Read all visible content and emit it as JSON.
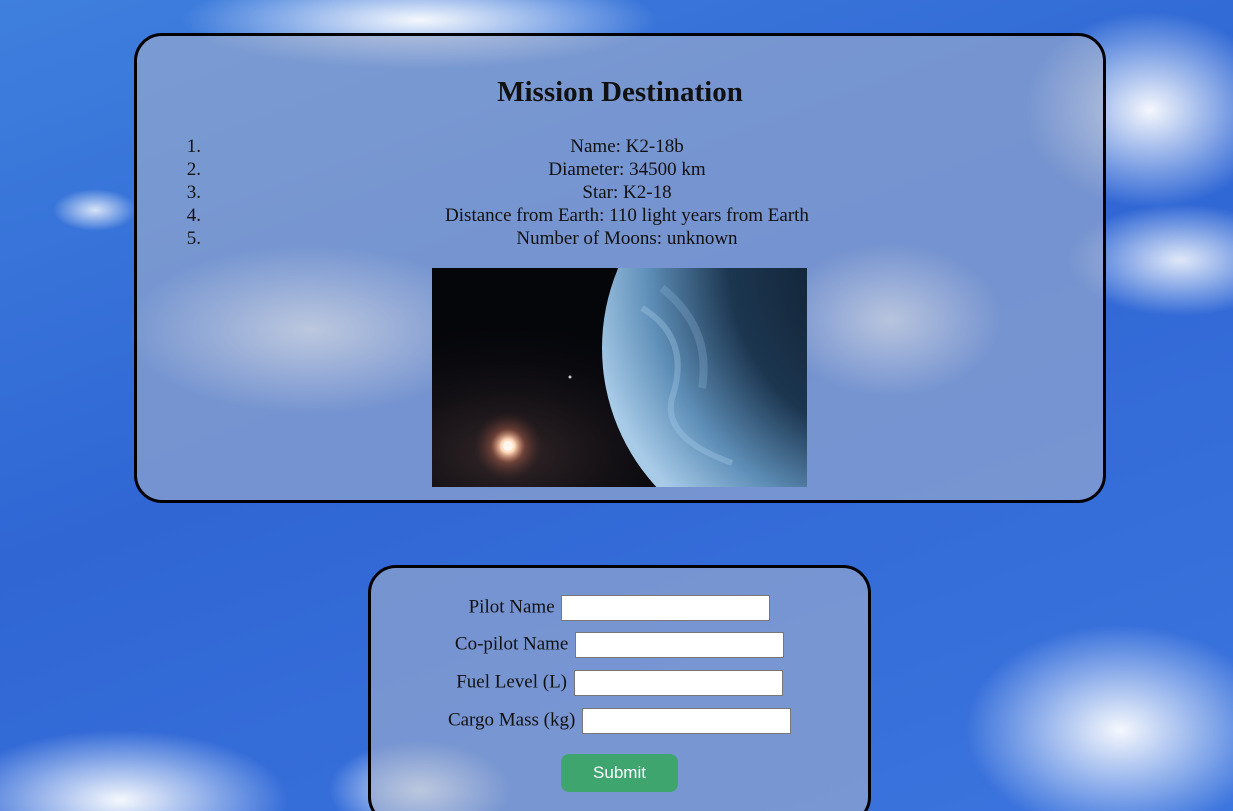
{
  "destination": {
    "heading": "Mission Destination",
    "items": [
      {
        "num": "1.",
        "text": "Name: K2-18b"
      },
      {
        "num": "2.",
        "text": "Diameter: 34500 km"
      },
      {
        "num": "3.",
        "text": "Star: K2-18"
      },
      {
        "num": "4.",
        "text": "Distance from Earth: 110 light years from Earth"
      },
      {
        "num": "5.",
        "text": "Number of Moons: unknown"
      }
    ],
    "image": {
      "icon": "exoplanet-image"
    }
  },
  "form": {
    "fields": [
      {
        "label": "Pilot Name",
        "value": ""
      },
      {
        "label": "Co-pilot Name",
        "value": ""
      },
      {
        "label": "Fuel Level (L)",
        "value": ""
      },
      {
        "label": "Cargo Mass (kg)",
        "value": ""
      }
    ],
    "submit_label": "Submit"
  },
  "colors": {
    "sky": "#2f66d4",
    "submit": "#3fa56e",
    "panel_border": "#000000"
  }
}
